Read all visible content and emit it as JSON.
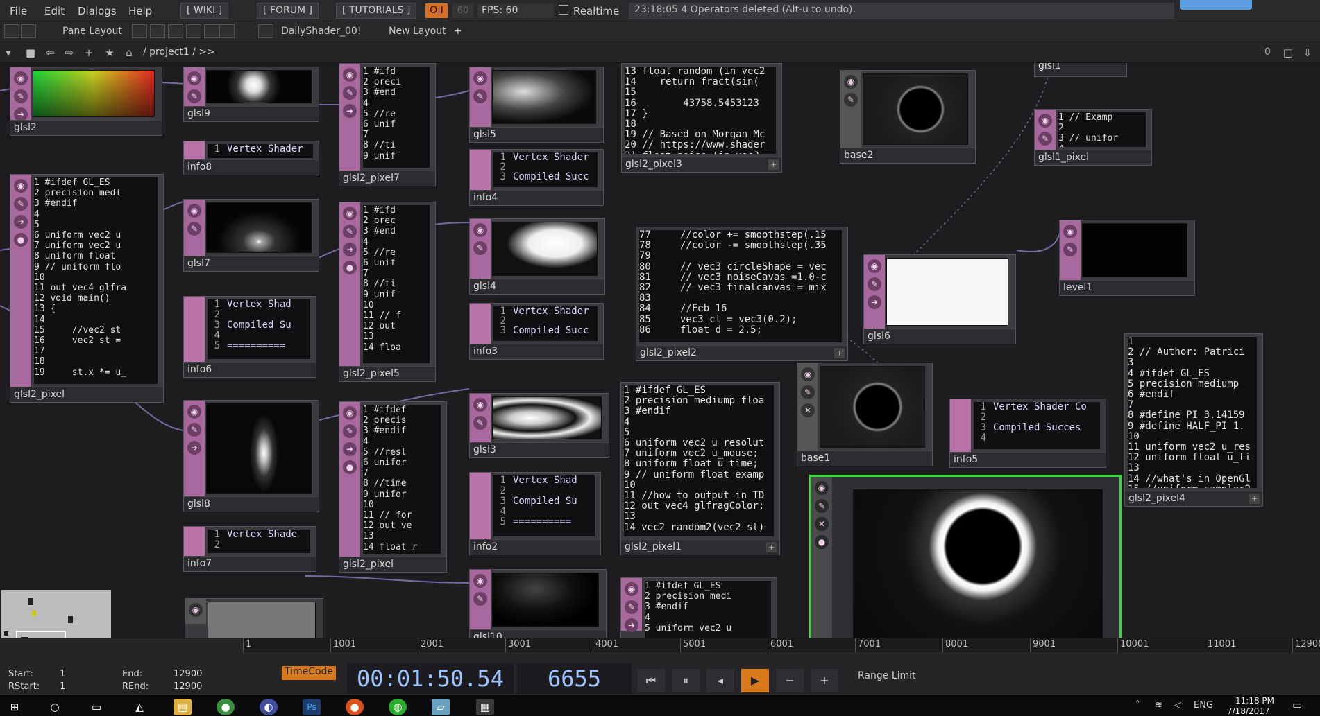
{
  "menu": [
    "File",
    "Edit",
    "Dialogs",
    "Help"
  ],
  "links": {
    "wiki": "[ WIKI ]",
    "forum": "[ FORUM ]",
    "tutorials": "[ TUTORIALS ]"
  },
  "status": {
    "oi": "O|I",
    "fps_target": "60",
    "fps": "FPS:  60",
    "realtime": "Realtime",
    "message": "23:18:05 4 Operators deleted (Alt-u to undo)."
  },
  "toolbar1": {
    "pane_layout": "Pane Layout",
    "tab": "DailyShader_00!",
    "new_layout": "New Layout"
  },
  "toolbar2": {
    "path": "/ project1 / >>",
    "right_num": "0"
  },
  "nodes": [
    {
      "id": "glsl2",
      "label": "glsl2"
    },
    {
      "id": "glsl9",
      "label": "glsl9"
    },
    {
      "id": "info8",
      "label": "info8",
      "line": "Vertex Shader"
    },
    {
      "id": "glsl2_pixel7",
      "label": "glsl2_pixel7"
    },
    {
      "id": "glsl5",
      "label": "glsl5"
    },
    {
      "id": "info4",
      "label": "info4",
      "lines": [
        "Vertex Shader",
        "",
        "Compiled Succ"
      ]
    },
    {
      "id": "glsl2_pixel3",
      "label": "glsl2_pixel3"
    },
    {
      "id": "base2",
      "label": "base2"
    },
    {
      "id": "glsl1",
      "label": "glsl1"
    },
    {
      "id": "glsl1_pixel",
      "label": "glsl1_pixel"
    },
    {
      "id": "glsl2_pixel",
      "label": "glsl2_pixel"
    },
    {
      "id": "glsl7",
      "label": "glsl7"
    },
    {
      "id": "glsl2_pixel5",
      "label": "glsl2_pixel5"
    },
    {
      "id": "glsl4",
      "label": "glsl4"
    },
    {
      "id": "info6",
      "label": "info6"
    },
    {
      "id": "info3",
      "label": "info3"
    },
    {
      "id": "glsl2_pixel2",
      "label": "glsl2_pixel2"
    },
    {
      "id": "glsl6",
      "label": "glsl6"
    },
    {
      "id": "level1",
      "label": "level1"
    },
    {
      "id": "glsl8",
      "label": "glsl8"
    },
    {
      "id": "glsl3",
      "label": "glsl3"
    },
    {
      "id": "info2",
      "label": "info2"
    },
    {
      "id": "glsl2_pixel1",
      "label": "glsl2_pixel1"
    },
    {
      "id": "base1",
      "label": "base1"
    },
    {
      "id": "info5",
      "label": "info5"
    },
    {
      "id": "glsl2_pixel4",
      "label": "glsl2_pixel4"
    },
    {
      "id": "info7",
      "label": "info7"
    },
    {
      "id": "glsl2_pixel6",
      "label": "glsl2_pixel"
    },
    {
      "id": "glsl10",
      "label": "glsl10"
    }
  ],
  "code": {
    "pixel": "1 #ifdef GL_ES\n2 precision medi\n3 #endif\n4\n5\n6 uniform vec2 u\n7 uniform vec2 u\n8 uniform float\n9 // uniform flo\n10\n11 out vec4 glfra\n12 void main()\n13 {\n14\n15     //vec2 st\n16     vec2 st =\n17\n18\n19     st.x *= u_",
    "pixel7": "1 #ifd\n2 preci\n3 #end\n4\n5 //re\n6 unif\n7\n8 //ti\n9 unif",
    "pixel5": "1 #ifd\n2 prec\n3 #end\n4\n5 //re\n6 unif\n7\n8 //ti\n9 unif\n10\n11 // f\n12 out\n13\n14 floa",
    "pixel6": "1 #ifdef\n2 precis\n3 #endif\n4\n5 //resl\n6 unifor\n7\n8 //time\n9 unifor\n10\n11 // for\n12 out ve\n13\n14 float r",
    "pixel3": "13 float random (in vec2\n14    return fract(sin(\n15\n16        43758.5453123\n17 }\n18\n19 // Based on Morgan Mc\n20 // https://www.shader\n21 float noise (in vec2\n22     vec2 i = floor(_s",
    "pixel2": "77     //color += smoothstep(.15\n78     //color -= smoothstep(.35\n79\n80     // vec3 circleShape = vec\n81     // vec3 noiseCavas =1.0-c\n82     // vec3 finalcanvas = mix\n83\n84     //Feb 16\n85     vec3 cl = vec3(0.2);\n86     float d = 2.5;",
    "pixel1": "1 #ifdef GL_ES\n2 precision mediump floa\n3 #endif\n4\n5\n6 uniform vec2 u_resolut\n7 uniform vec2 u_mouse;\n8 uniform float u_time;\n9 // uniform float examp\n10\n11 //how to output in TD\n12 out vec4 glfragColor;\n13\n14 vec2 random2(vec2 st)",
    "pixel4": "1\n2 // Author: Patrici\n3\n4 #ifdef GL_ES\n5 precision mediump\n6 #endif\n7\n8 #define PI 3.14159\n9 #define HALF_PI 1.\n10\n11 uniform vec2 u_res\n12 uniform float u_ti\n13\n14 //what's in OpenGl\n15 //uniform sampler2",
    "glsl1px": "1 // Examp\n2\n3 // unifor\n4\n5 out vec4",
    "bottom": "1 #ifdef GL_ES\n2 precision medi\n3 #endif\n4\n5 uniform vec2 u"
  },
  "info": {
    "vs": "Vertex Shader",
    "cs": "Compiled Succ",
    "vs_short": "Vertex Shad",
    "cs_short": "Compiled Su",
    "info5_vs": "Vertex Shader Co",
    "info5_cs": "Compiled Succes",
    "info7": "Vertex Shade",
    "dashes": "=========="
  },
  "timeline": {
    "ticks": [
      "1",
      "1001",
      "2001",
      "3001",
      "4001",
      "5001",
      "6001",
      "7001",
      "8001",
      "9001",
      "10001",
      "11001",
      "12900"
    ],
    "start_label": "Start:",
    "start": "1",
    "end_label": "End:",
    "end": "12900",
    "rstart_label": "RStart:",
    "rstart": "1",
    "rend_label": "REnd:",
    "rend": "12900",
    "timecode": "TimeCode",
    "time": "00:01:50.54",
    "frame": "6655",
    "range_limit": "Range Limit"
  },
  "taskbar": {
    "lang": "ENG",
    "clock": "11:18 PM",
    "date": "7/18/2017"
  }
}
